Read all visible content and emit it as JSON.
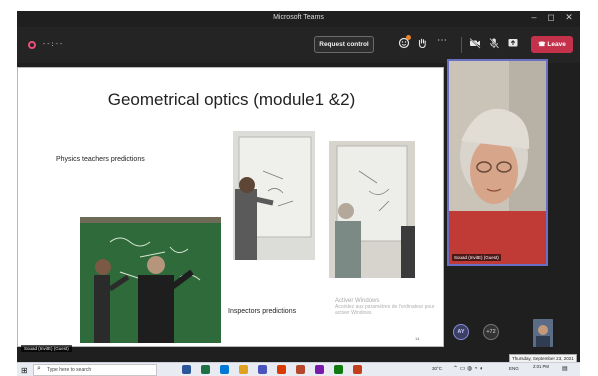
{
  "window": {
    "title": "Microsoft Teams",
    "minimize_glyph": "–",
    "maximize_glyph": "◻",
    "close_glyph": "✕"
  },
  "toolbar": {
    "timer": "--:--",
    "request_control_label": "Request control",
    "leave_label": "Leave",
    "leave_color": "#c4314b",
    "icons": [
      "reactions-icon",
      "raise-hand-icon",
      "more-options-icon",
      "camera-off-icon",
      "mic-off-icon",
      "share-tray-icon",
      "phone-hangup-icon"
    ]
  },
  "slide": {
    "title": "Geometrical optics (module1 &2)",
    "subtitle": "Physics teachers predictions",
    "inspectors_label": "Inspectors predictions",
    "watermark_heading": "Activer Windows",
    "watermark_body_1": "Accédez aux paramètres de l'ordinateur pour",
    "watermark_body_2": "activer Windows.",
    "page_number": "14"
  },
  "video_tile": {
    "name": "Souad (InvitE) (Guest)"
  },
  "participants": {
    "avatar_initials": "AY",
    "more_count": "+72",
    "sharer_label": "Souad (InvitE) (Guest)"
  },
  "taskbar": {
    "search_placeholder": "Type here to search",
    "temperature": "30°C",
    "language": "ENG",
    "time": "2:01 PM",
    "date_tooltip": "Thursday, September 23, 2021",
    "app_colors": [
      "#2b579a",
      "#1e7145",
      "#0078d7",
      "#e2a020",
      "#4b53bc",
      "#d83b01",
      "#b7472a",
      "#7719aa",
      "#0f7b0f",
      "#c43e1c"
    ]
  }
}
